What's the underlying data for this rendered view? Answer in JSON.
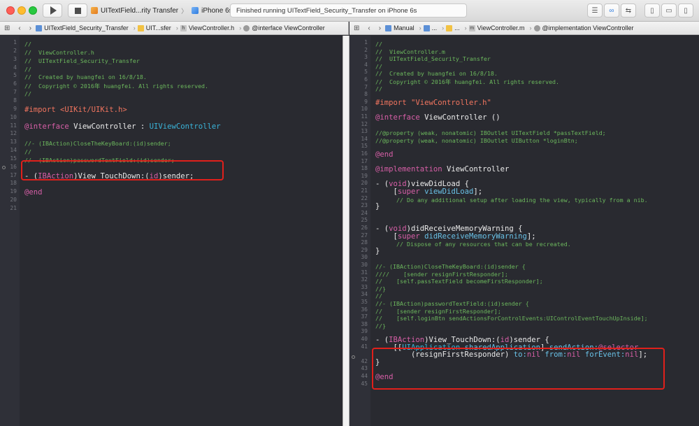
{
  "toolbar": {
    "scheme_label": "UITextField...rity Transfer",
    "device_label": "iPhone 6s",
    "status_text": "Finished running UITextField_Security_Transfer on iPhone 6s"
  },
  "left_jumpbar": {
    "items": [
      "UITextField_Security_Transfer",
      "UIT...sfer",
      "ViewController.h",
      "@interface ViewController"
    ]
  },
  "right_jumpbar": {
    "items": [
      "Manual",
      "...",
      "...",
      "ViewController.m",
      "@implementation ViewController"
    ]
  },
  "left_editor": {
    "lines": [
      {
        "n": "1",
        "s": "s",
        "t": [
          {
            "c": "comment",
            "x": "//"
          }
        ]
      },
      {
        "n": "2",
        "s": "s",
        "t": [
          {
            "c": "comment",
            "x": "//  ViewController.h"
          }
        ]
      },
      {
        "n": "3",
        "s": "s",
        "t": [
          {
            "c": "comment",
            "x": "//  UITextField_Security_Transfer"
          }
        ]
      },
      {
        "n": "4",
        "s": "s",
        "t": [
          {
            "c": "comment",
            "x": "//"
          }
        ]
      },
      {
        "n": "5",
        "s": "s",
        "t": [
          {
            "c": "comment",
            "x": "//  Created by huangfei on 16/8/18."
          }
        ]
      },
      {
        "n": "6",
        "s": "s",
        "t": [
          {
            "c": "comment",
            "x": "//  Copyright © 2016年 huangfei. All rights reserved."
          }
        ]
      },
      {
        "n": "7",
        "s": "s",
        "t": [
          {
            "c": "comment",
            "x": "//"
          }
        ]
      },
      {
        "n": "8",
        "s": "s",
        "t": []
      },
      {
        "n": "9",
        "s": "m",
        "t": [
          {
            "c": "pp",
            "x": "#import "
          },
          {
            "c": "ppstr",
            "x": "<UIKit/UIKit.h>"
          }
        ]
      },
      {
        "n": "10",
        "s": "s",
        "t": []
      },
      {
        "n": "11",
        "s": "m",
        "t": [
          {
            "c": "kw",
            "x": "@interface"
          },
          {
            "c": "plain",
            "x": " ViewController : "
          },
          {
            "c": "type",
            "x": "UIViewController"
          }
        ]
      },
      {
        "n": "12",
        "s": "s",
        "t": []
      },
      {
        "n": "13",
        "s": "s",
        "t": [
          {
            "c": "comment",
            "x": "//- (IBAction)CloseTheKeyBoard:(id)sender;"
          }
        ]
      },
      {
        "n": "14",
        "s": "s",
        "t": [
          {
            "c": "comment",
            "x": "//"
          }
        ]
      },
      {
        "n": "15",
        "s": "s",
        "t": [
          {
            "c": "comment",
            "x": "//- (IBAction)passwordTextField:(id)sender;"
          }
        ]
      },
      {
        "n": "16",
        "s": "s",
        "t": []
      },
      {
        "n": "17",
        "s": "m",
        "t": [
          {
            "c": "plain",
            "x": "- ("
          },
          {
            "c": "kw",
            "x": "IBAction"
          },
          {
            "c": "plain",
            "x": ")View_TouchDown:("
          },
          {
            "c": "kw",
            "x": "id"
          },
          {
            "c": "plain",
            "x": ")sender;"
          }
        ]
      },
      {
        "n": "18",
        "s": "s",
        "t": []
      },
      {
        "n": "19",
        "s": "m",
        "t": [
          {
            "c": "kw",
            "x": "@end"
          }
        ]
      },
      {
        "n": "20",
        "s": "s",
        "t": []
      },
      {
        "n": "21",
        "s": "s",
        "t": []
      }
    ]
  },
  "right_editor": {
    "lines": [
      {
        "n": "1",
        "s": "s",
        "t": [
          {
            "c": "comment",
            "x": "//"
          }
        ]
      },
      {
        "n": "2",
        "s": "s",
        "t": [
          {
            "c": "comment",
            "x": "//  ViewController.m"
          }
        ]
      },
      {
        "n": "3",
        "s": "s",
        "t": [
          {
            "c": "comment",
            "x": "//  UITextField_Security_Transfer"
          }
        ]
      },
      {
        "n": "4",
        "s": "s",
        "t": [
          {
            "c": "comment",
            "x": "//"
          }
        ]
      },
      {
        "n": "5",
        "s": "s",
        "t": [
          {
            "c": "comment",
            "x": "//  Created by huangfei on 16/8/18."
          }
        ]
      },
      {
        "n": "6",
        "s": "s",
        "t": [
          {
            "c": "comment",
            "x": "//  Copyright © 2016年 huangfei. All rights reserved."
          }
        ]
      },
      {
        "n": "7",
        "s": "s",
        "t": [
          {
            "c": "comment",
            "x": "//"
          }
        ]
      },
      {
        "n": "8",
        "s": "s",
        "t": []
      },
      {
        "n": "9",
        "s": "m",
        "t": [
          {
            "c": "pp",
            "x": "#import "
          },
          {
            "c": "ppstr",
            "x": "\"ViewController.h\""
          }
        ]
      },
      {
        "n": "10",
        "s": "s",
        "t": []
      },
      {
        "n": "11",
        "s": "m",
        "t": [
          {
            "c": "kw",
            "x": "@interface"
          },
          {
            "c": "plain",
            "x": " ViewController ()"
          }
        ]
      },
      {
        "n": "12",
        "s": "s",
        "t": []
      },
      {
        "n": "13",
        "s": "s",
        "t": [
          {
            "c": "comment",
            "x": "//@property (weak, nonatomic) IBOutlet UITextField *passTextField;"
          }
        ]
      },
      {
        "n": "14",
        "s": "s",
        "t": [
          {
            "c": "comment",
            "x": "//@property (weak, nonatomic) IBOutlet UIButton *loginBtn;"
          }
        ]
      },
      {
        "n": "15",
        "s": "s",
        "t": []
      },
      {
        "n": "16",
        "s": "m",
        "t": [
          {
            "c": "kw",
            "x": "@end"
          }
        ]
      },
      {
        "n": "17",
        "s": "s",
        "t": []
      },
      {
        "n": "18",
        "s": "m",
        "t": [
          {
            "c": "kw",
            "x": "@implementation"
          },
          {
            "c": "plain",
            "x": " ViewController"
          }
        ]
      },
      {
        "n": "19",
        "s": "s",
        "t": []
      },
      {
        "n": "20",
        "s": "m",
        "t": [
          {
            "c": "plain",
            "x": "- ("
          },
          {
            "c": "kw",
            "x": "void"
          },
          {
            "c": "plain",
            "x": ")viewDidLoad {"
          }
        ]
      },
      {
        "n": "21",
        "s": "m",
        "t": [
          {
            "c": "plain",
            "x": "    ["
          },
          {
            "c": "kw",
            "x": "super"
          },
          {
            "c": "plain",
            "x": " "
          },
          {
            "c": "method",
            "x": "viewDidLoad"
          },
          {
            "c": "plain",
            "x": "];"
          }
        ]
      },
      {
        "n": "22",
        "s": "s",
        "t": [
          {
            "c": "comment",
            "x": "      // Do any additional setup after loading the view, typically from a nib."
          }
        ]
      },
      {
        "n": "23",
        "s": "m",
        "t": [
          {
            "c": "plain",
            "x": "}"
          }
        ]
      },
      {
        "n": "24",
        "s": "s",
        "t": []
      },
      {
        "n": "25",
        "s": "s",
        "t": []
      },
      {
        "n": "26",
        "s": "m",
        "t": [
          {
            "c": "plain",
            "x": "- ("
          },
          {
            "c": "kw",
            "x": "void"
          },
          {
            "c": "plain",
            "x": ")didReceiveMemoryWarning {"
          }
        ]
      },
      {
        "n": "27",
        "s": "m",
        "t": [
          {
            "c": "plain",
            "x": "    ["
          },
          {
            "c": "kw",
            "x": "super"
          },
          {
            "c": "plain",
            "x": " "
          },
          {
            "c": "method",
            "x": "didReceiveMemoryWarning"
          },
          {
            "c": "plain",
            "x": "];"
          }
        ]
      },
      {
        "n": "28",
        "s": "s",
        "t": [
          {
            "c": "comment",
            "x": "      // Dispose of any resources that can be recreated."
          }
        ]
      },
      {
        "n": "29",
        "s": "m",
        "t": [
          {
            "c": "plain",
            "x": "}"
          }
        ]
      },
      {
        "n": "30",
        "s": "s",
        "t": []
      },
      {
        "n": "30",
        "s": "s",
        "t": [
          {
            "c": "comment",
            "x": "//- (IBAction)CloseTheKeyBoard:(id)sender {"
          }
        ]
      },
      {
        "n": "31",
        "s": "s",
        "t": [
          {
            "c": "comment",
            "x": "////    [sender resignFirstResponder];"
          }
        ]
      },
      {
        "n": "32",
        "s": "s",
        "t": [
          {
            "c": "comment",
            "x": "//    [self.passTextField becomeFirstResponder];"
          }
        ]
      },
      {
        "n": "33",
        "s": "s",
        "t": [
          {
            "c": "comment",
            "x": "//}"
          }
        ]
      },
      {
        "n": "34",
        "s": "s",
        "t": [
          {
            "c": "comment",
            "x": "//"
          }
        ]
      },
      {
        "n": "35",
        "s": "s",
        "t": [
          {
            "c": "comment",
            "x": "//- (IBAction)passwordTextField:(id)sender {"
          }
        ]
      },
      {
        "n": "36",
        "s": "s",
        "t": [
          {
            "c": "comment",
            "x": "//    [sender resignFirstResponder];"
          }
        ]
      },
      {
        "n": "37",
        "s": "s",
        "t": [
          {
            "c": "comment",
            "x": "//    [self.loginBtn sendActionsForControlEvents:UIControlEventTouchUpInside];"
          }
        ]
      },
      {
        "n": "38",
        "s": "s",
        "t": [
          {
            "c": "comment",
            "x": "//}"
          }
        ]
      },
      {
        "n": "39",
        "s": "s",
        "t": []
      },
      {
        "n": "40",
        "s": "m",
        "t": [
          {
            "c": "plain",
            "x": "- ("
          },
          {
            "c": "kw",
            "x": "IBAction"
          },
          {
            "c": "plain",
            "x": ")View_TouchDown:("
          },
          {
            "c": "kw",
            "x": "id"
          },
          {
            "c": "plain",
            "x": ")sender {"
          }
        ]
      },
      {
        "n": "41",
        "s": "m",
        "t": [
          {
            "c": "plain",
            "x": "    [["
          },
          {
            "c": "type",
            "x": "UIApplication"
          },
          {
            "c": "plain",
            "x": " "
          },
          {
            "c": "method",
            "x": "sharedApplication"
          },
          {
            "c": "plain",
            "x": "] "
          },
          {
            "c": "method",
            "x": "sendAction:"
          },
          {
            "c": "kw",
            "x": "@selector"
          }
        ]
      },
      {
        "n": "",
        "s": "m",
        "t": [
          {
            "c": "plain",
            "x": "        (resignFirstResponder) "
          },
          {
            "c": "method",
            "x": "to:"
          },
          {
            "c": "kw",
            "x": "nil"
          },
          {
            "c": "plain",
            "x": " "
          },
          {
            "c": "method",
            "x": "from:"
          },
          {
            "c": "kw",
            "x": "nil"
          },
          {
            "c": "plain",
            "x": " "
          },
          {
            "c": "method",
            "x": "forEvent:"
          },
          {
            "c": "kw",
            "x": "nil"
          },
          {
            "c": "plain",
            "x": "];"
          }
        ]
      },
      {
        "n": "42",
        "s": "m",
        "t": [
          {
            "c": "plain",
            "x": "}"
          }
        ]
      },
      {
        "n": "43",
        "s": "s",
        "t": []
      },
      {
        "n": "44",
        "s": "m",
        "t": [
          {
            "c": "kw",
            "x": "@end"
          }
        ]
      },
      {
        "n": "45",
        "s": "s",
        "t": []
      }
    ]
  }
}
